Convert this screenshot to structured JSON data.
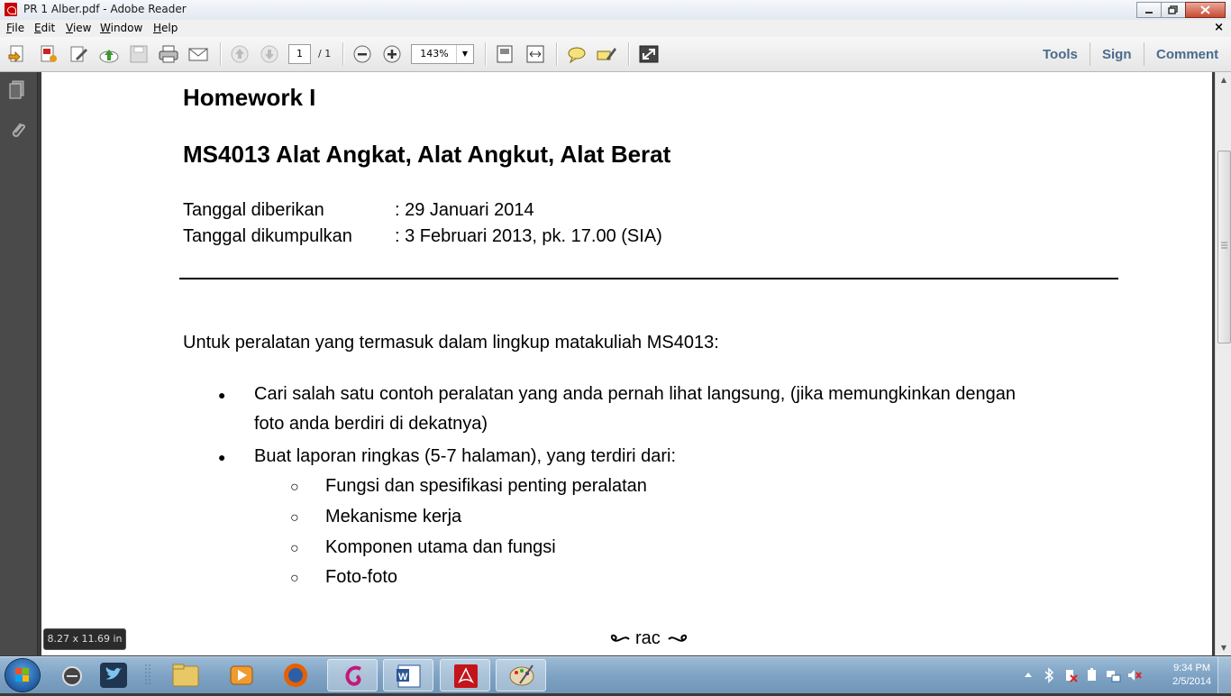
{
  "window": {
    "title": "PR 1 Alber.pdf - Adobe Reader",
    "minimize": "0",
    "restore": "1",
    "close": "r"
  },
  "menu": {
    "items": [
      "File",
      "Edit",
      "View",
      "Window",
      "Help"
    ],
    "close_doc": "×"
  },
  "toolbar": {
    "page_current": "1",
    "page_total": "/ 1",
    "zoom": "143%",
    "tools": "Tools",
    "sign": "Sign",
    "comment": "Comment"
  },
  "document": {
    "heading1": "Homework I",
    "heading2": "MS4013 Alat Angkat, Alat Angkut, Alat Berat",
    "date_given_label": "Tanggal diberikan",
    "date_given_value": ":  29 Januari 2014",
    "date_due_label": "Tanggal dikumpulkan",
    "date_due_value": ":  3 Februari 2013, pk. 17.00 (SIA)",
    "intro": "Untuk peralatan yang termasuk dalam lingkup matakuliah MS4013:",
    "bullet1_line1": "Cari salah satu contoh peralatan yang anda pernah lihat langsung, (jika memungkinkan dengan",
    "bullet1_line2": "foto anda berdiri di dekatnya)",
    "bullet2": "Buat laporan ringkas (5-7 halaman), yang terdiri dari:",
    "sub_items": [
      "Fungsi dan spesifikasi penting peralatan",
      "Mekanisme kerja",
      "Komponen utama dan fungsi",
      "Foto-foto"
    ],
    "footer_mark": "rac",
    "bullet_char": "●",
    "sub_bullet_char": "○"
  },
  "status": {
    "page_size": "8.27 x 11.69 in"
  },
  "taskbar": {
    "time": "9:34 PM",
    "date": "2/5/2014"
  }
}
